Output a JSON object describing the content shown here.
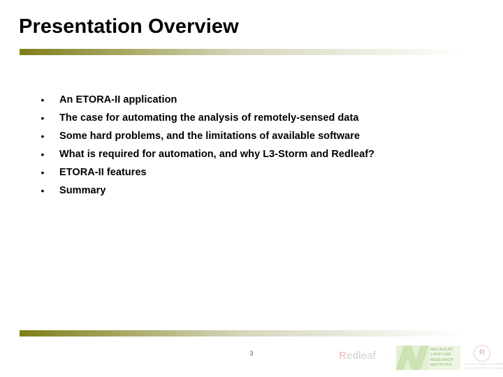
{
  "slide": {
    "title": "Presentation Overview",
    "page_number": "3",
    "background_color": "#ffffff",
    "text_color": "#000000"
  },
  "decor": {
    "rule_gradient_start": "#7f7f17",
    "rule_gradient_mid": "#d6d6bd",
    "rule_gradient_end": "#ffffff",
    "title_rule_name": "title-underline-gradient-bar",
    "footer_rule_name": "footer-gradient-bar"
  },
  "content": {
    "bullet_marker": "•",
    "bullets": [
      {
        "text": "An ETORA-II application"
      },
      {
        "text": "The case for automating the analysis of remotely-sensed data"
      },
      {
        "text": "Some hard problems, and the limitations of available software"
      },
      {
        "text": "What is required for automation, and why L3-Storm and Redleaf?"
      },
      {
        "text": "ETORA-II features"
      },
      {
        "text": "Summary"
      }
    ]
  },
  "footer": {
    "redleaf": {
      "initial": "R",
      "remainder": "edleaf",
      "initial_color": "#e8b6b6",
      "remainder_color": "#cfcfcf"
    },
    "macaulay": {
      "mark_color": "#cde3b4",
      "panel_color": "#e4f0d6",
      "lines": [
        "MACAULAY",
        "LAND USE",
        "RESEARCH",
        "INSTITUTE"
      ]
    },
    "partner": {
      "mark_glyph": "R",
      "mark_color": "#e0bcc6",
      "lines": [
        "COMPUTER SCIENCE",
        "UNIVERSITY OF ABERDEEN"
      ]
    }
  }
}
